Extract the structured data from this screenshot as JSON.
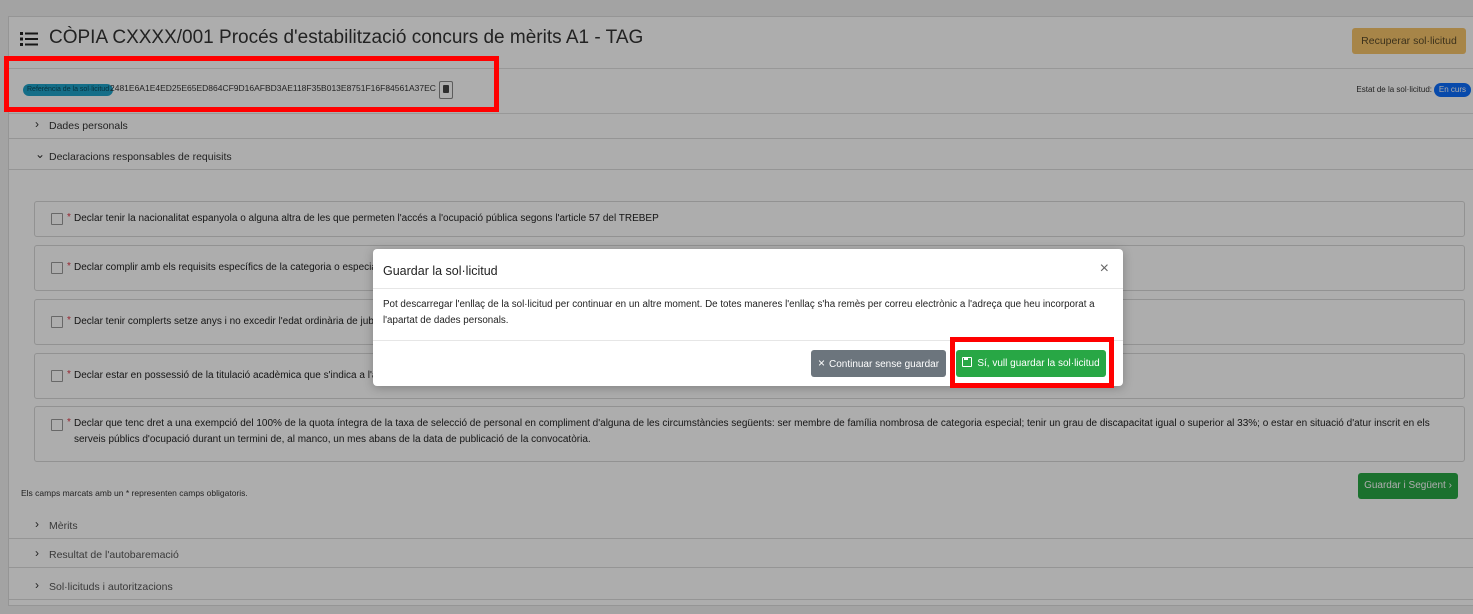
{
  "header": {
    "title": "CÒPIA CXXXX/001 Procés d'estabilització concurs de mèrits A1 - TAG",
    "recover_label": "Recuperar sol·licitud"
  },
  "reference": {
    "label": "Referència de la sol·licitud",
    "code": "2481E6A1E4ED25E65ED864CF9D16AFBD3AE118F35B013E8751F16F84561A37EC"
  },
  "status": {
    "label": "Estat de la sol·licitud:",
    "badge": "En curs"
  },
  "sections": {
    "dades_personals": "Dades personals",
    "declaracions": "Declaracions responsables de requisits",
    "merits": "Mèrits",
    "resultat": "Resultat de l'autobaremació",
    "sollicituds": "Sol·licituds i autoritzacions"
  },
  "requirements": [
    "Declar tenir la nacionalitat espanyola o alguna altra de les que permeten l'accés a l'ocupació pública segons l'article 57 del TREBEP",
    "Declar complir amb els requisits específics de la categoria o especia",
    "Declar tenir complerts setze anys i no excedir l'edat ordinària de jub",
    "Declar estar en possessió de la titulació acadèmica que s'indica a l'a",
    "Declar que tenc dret a una exempció del 100% de la quota íntegra de la taxa de selecció de personal en compliment d'alguna de les circumstàncies següents: ser membre de família nombrosa de categoria especial; tenir un grau de discapacitat igual o superior al 33%; o estar en situació d'atur inscrit en els serveis públics d'ocupació durant un termini de, al manco, un mes abans de la data de publicació de la convocatòria."
  ],
  "required_mark": "*",
  "note": "Els camps marcats amb un * representen camps obligatoris.",
  "next_label": "Guardar i Següent",
  "next_arrow": "›",
  "modal": {
    "title": "Guardar la sol·licitud",
    "close": "×",
    "body": "Pot descarregar l'enllaç de la sol·licitud per continuar en un altre moment. De totes maneres l'enllaç s'ha remès per correu electrònic a l'adreça que heu incorporat a l'apartat de dades personals.",
    "continue_label": "Continuar sense guardar",
    "continue_icon": "×",
    "save_label": "Sí, vull guardar la sol·licitud"
  },
  "colors": {
    "accent_green": "#28a745",
    "warning": "#f7c56a",
    "info": "#1ea3c9",
    "primary": "#0d6efd",
    "highlight": "#ff0000"
  },
  "icons": {
    "list": "list-icon",
    "clipboard": "clipboard-icon",
    "chevron_right": "chevron-right-icon",
    "chevron_down": "chevron-down-icon",
    "floppy": "floppy-disk-icon"
  }
}
